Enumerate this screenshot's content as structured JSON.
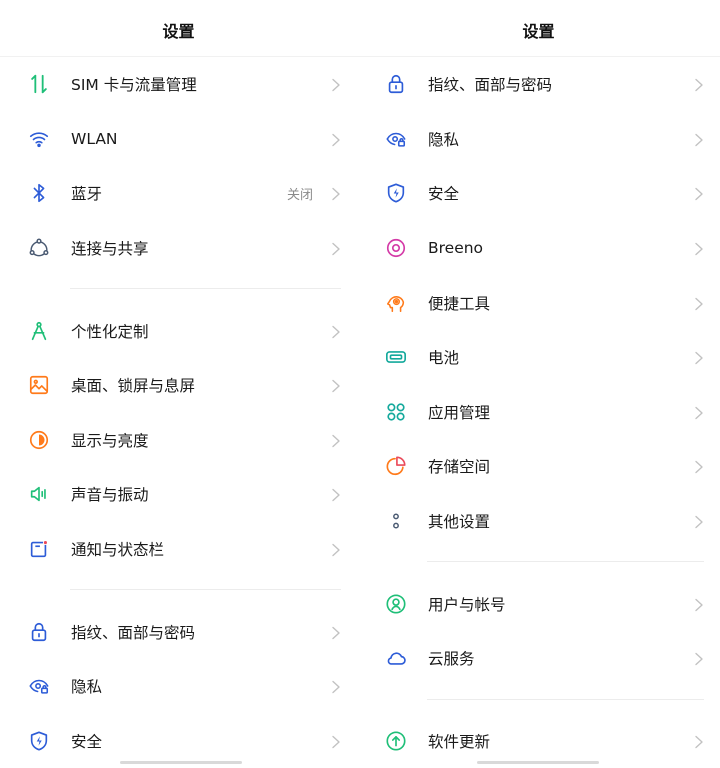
{
  "colors": {
    "green": "#1fbf78",
    "blue": "#2d5cd7",
    "orange": "#ff7a1a",
    "magenta": "#d43aa7",
    "teal": "#14a99c",
    "red": "#ea4a5a",
    "chevron": "#c2c2c2"
  },
  "left": {
    "title": "设置",
    "groups": [
      [
        {
          "icon": "sim-card-traffic-icon",
          "label": "SIM 卡与流量管理"
        },
        {
          "icon": "wifi-icon",
          "label": "WLAN"
        },
        {
          "icon": "bluetooth-icon",
          "label": "蓝牙",
          "value": "关闭"
        },
        {
          "icon": "connection-share-icon",
          "label": "连接与共享"
        }
      ],
      [
        {
          "icon": "personalization-icon",
          "label": "个性化定制"
        },
        {
          "icon": "wallpaper-icon",
          "label": "桌面、锁屏与息屏"
        },
        {
          "icon": "brightness-icon",
          "label": "显示与亮度"
        },
        {
          "icon": "sound-vibration-icon",
          "label": "声音与振动"
        },
        {
          "icon": "notification-bar-icon",
          "label": "通知与状态栏"
        }
      ],
      [
        {
          "icon": "lock-icon",
          "label": "指纹、面部与密码"
        },
        {
          "icon": "privacy-eye-icon",
          "label": "隐私"
        },
        {
          "icon": "security-shield-icon",
          "label": "安全"
        }
      ]
    ]
  },
  "right": {
    "title": "设置",
    "groups": [
      [
        {
          "icon": "lock-icon",
          "label": "指纹、面部与密码"
        },
        {
          "icon": "privacy-eye-icon",
          "label": "隐私"
        },
        {
          "icon": "security-shield-icon",
          "label": "安全"
        },
        {
          "icon": "breeno-icon",
          "label": "Breeno"
        },
        {
          "icon": "smart-tools-icon",
          "label": "便捷工具"
        },
        {
          "icon": "battery-icon",
          "label": "电池"
        },
        {
          "icon": "app-management-icon",
          "label": "应用管理"
        },
        {
          "icon": "storage-icon",
          "label": "存储空间"
        },
        {
          "icon": "more-settings-icon",
          "label": "其他设置"
        }
      ],
      [
        {
          "icon": "user-account-icon",
          "label": "用户与帐号"
        },
        {
          "icon": "cloud-icon",
          "label": "云服务"
        }
      ],
      [
        {
          "icon": "software-update-icon",
          "label": "软件更新"
        }
      ]
    ]
  }
}
